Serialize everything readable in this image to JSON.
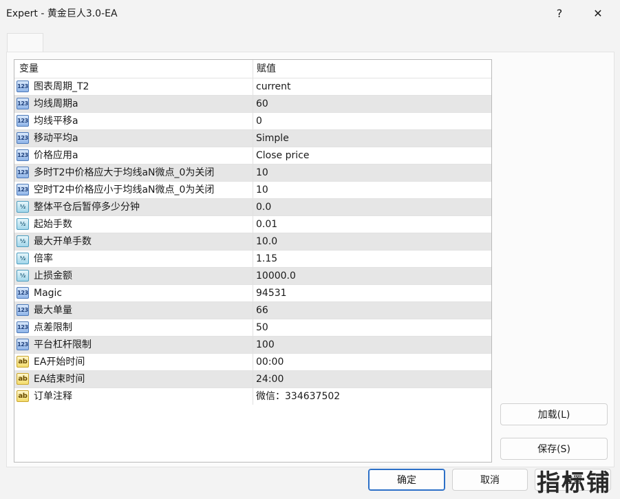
{
  "window": {
    "title": "Expert - 黄金巨人3.0-EA",
    "help_glyph": "?",
    "close_glyph": "✕"
  },
  "tabs": [
    {
      "label": ""
    }
  ],
  "grid": {
    "headers": {
      "variable": "变量",
      "value": "赋值"
    },
    "rows": [
      {
        "type": "int",
        "icon": "123",
        "name": "图表周期_T2",
        "value": "current"
      },
      {
        "type": "int",
        "icon": "123",
        "name": "均线周期a",
        "value": "60"
      },
      {
        "type": "int",
        "icon": "123",
        "name": "均线平移a",
        "value": "0"
      },
      {
        "type": "int",
        "icon": "123",
        "name": "移动平均a",
        "value": "Simple"
      },
      {
        "type": "int",
        "icon": "123",
        "name": "价格应用a",
        "value": "Close price"
      },
      {
        "type": "int",
        "icon": "123",
        "name": "多时T2中价格应大于均线aN微点_0为关闭",
        "value": "10"
      },
      {
        "type": "int",
        "icon": "123",
        "name": "空时T2中价格应小于均线aN微点_0为关闭",
        "value": "10"
      },
      {
        "type": "double",
        "icon": "½",
        "name": "整体平仓后暂停多少分钟",
        "value": "0.0"
      },
      {
        "type": "double",
        "icon": "½",
        "name": "起始手数",
        "value": "0.01"
      },
      {
        "type": "double",
        "icon": "½",
        "name": "最大开单手数",
        "value": "10.0"
      },
      {
        "type": "double",
        "icon": "½",
        "name": "倍率",
        "value": "1.15"
      },
      {
        "type": "double",
        "icon": "½",
        "name": "止损金额",
        "value": "10000.0"
      },
      {
        "type": "int",
        "icon": "123",
        "name": "Magic",
        "value": "94531"
      },
      {
        "type": "int",
        "icon": "123",
        "name": "最大单量",
        "value": "66"
      },
      {
        "type": "int",
        "icon": "123",
        "name": "点差限制",
        "value": "50"
      },
      {
        "type": "int",
        "icon": "123",
        "name": "平台杠杆限制",
        "value": "100"
      },
      {
        "type": "string",
        "icon": "ab",
        "name": "EA开始时间",
        "value": "00:00"
      },
      {
        "type": "string",
        "icon": "ab",
        "name": "EA结束时间",
        "value": "24:00"
      },
      {
        "type": "string",
        "icon": "ab",
        "name": "订单注释",
        "value": "微信：334637502"
      }
    ]
  },
  "buttons": {
    "load": "加载(L)",
    "save": "保存(S)",
    "ok": "确定",
    "cancel": "取消",
    "reset": "重置"
  },
  "watermark": "指标铺",
  "colors": {
    "row_alt": "#e6e6e6",
    "primary_border": "#2b6fc7"
  }
}
